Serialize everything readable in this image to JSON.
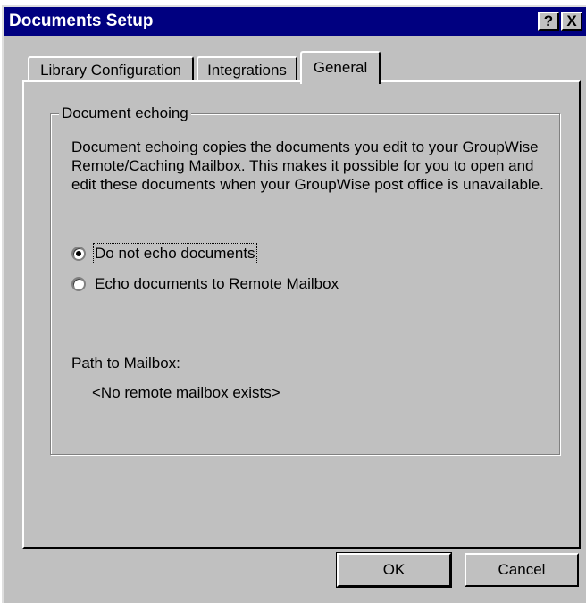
{
  "window": {
    "title": "Documents Setup",
    "help_button": "?",
    "close_button": "X"
  },
  "tabs": [
    {
      "label": "Library Configuration",
      "selected": false
    },
    {
      "label": "Integrations",
      "selected": false
    },
    {
      "label": "General",
      "selected": true
    }
  ],
  "group": {
    "label": "Document echoing",
    "description": "Document echoing copies the documents you edit to your GroupWise Remote/Caching Mailbox. This makes it possible for you to open and edit these documents when your GroupWise post office is unavailable.",
    "options": [
      {
        "label": "Do not echo documents",
        "selected": true
      },
      {
        "label": "Echo documents to Remote Mailbox",
        "selected": false
      }
    ],
    "path_label": "Path to Mailbox:",
    "path_value": "<No remote mailbox exists>"
  },
  "buttons": {
    "ok": "OK",
    "cancel": "Cancel"
  }
}
